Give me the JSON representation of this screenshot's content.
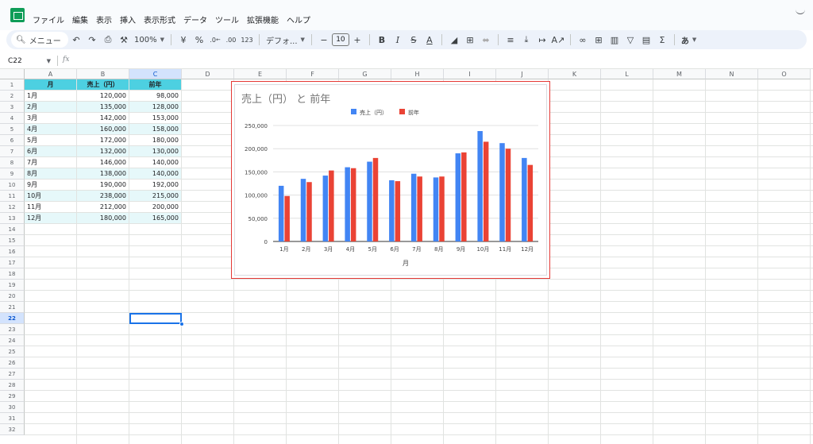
{
  "menu": {
    "items": [
      "ファイル",
      "編集",
      "表示",
      "挿入",
      "表示形式",
      "データ",
      "ツール",
      "拡張機能",
      "ヘルプ"
    ]
  },
  "toolbar": {
    "search_label": "メニュー",
    "zoom": "100%",
    "currency": "¥",
    "percent": "%",
    "dec_decrease": ".0←",
    "dec_increase": ".00",
    "number_format": "123",
    "font": "デフォ...",
    "font_size": "10",
    "bold": "B",
    "italic": "I",
    "strike": "S",
    "text_color": "A",
    "sum": "Σ",
    "input_tools": "あ",
    "icons": [
      "search-icon",
      "undo-icon",
      "redo-icon",
      "print-icon",
      "paint-format-icon",
      "zoom-dropdown-icon",
      "minus-icon",
      "plus-icon",
      "fill-color-icon",
      "borders-icon",
      "merge-cells-icon",
      "align-left-icon",
      "valign-icon",
      "wrap-icon",
      "rotate-icon",
      "link-icon",
      "comment-icon",
      "chart-icon",
      "filter-icon",
      "filter-views-icon",
      "functions-icon",
      "input-tools-icon"
    ]
  },
  "formula_bar": {
    "name_box": "C22",
    "fx": "fx"
  },
  "grid": {
    "columns": [
      "A",
      "B",
      "C",
      "D",
      "E",
      "F",
      "G",
      "H",
      "I",
      "J",
      "K",
      "L",
      "M",
      "N",
      "O"
    ],
    "rows": [
      "1",
      "2",
      "3",
      "4",
      "5",
      "6",
      "7",
      "8",
      "9",
      "10",
      "11",
      "12",
      "13",
      "14",
      "15",
      "16",
      "17",
      "18",
      "19",
      "20",
      "21",
      "22",
      "23",
      "24",
      "25",
      "26",
      "27",
      "28",
      "29",
      "30",
      "31",
      "32"
    ],
    "selected_column": "C",
    "selected_row": "22",
    "selected_cell": "C22"
  },
  "sheet": {
    "headers": [
      "月",
      "売上（円）",
      "前年"
    ],
    "rows": [
      [
        "1月",
        "120,000",
        "98,000"
      ],
      [
        "2月",
        "135,000",
        "128,000"
      ],
      [
        "3月",
        "142,000",
        "153,000"
      ],
      [
        "4月",
        "160,000",
        "158,000"
      ],
      [
        "5月",
        "172,000",
        "180,000"
      ],
      [
        "6月",
        "132,000",
        "130,000"
      ],
      [
        "7月",
        "146,000",
        "140,000"
      ],
      [
        "8月",
        "138,000",
        "140,000"
      ],
      [
        "9月",
        "190,000",
        "192,000"
      ],
      [
        "10月",
        "238,000",
        "215,000"
      ],
      [
        "11月",
        "212,000",
        "200,000"
      ],
      [
        "12月",
        "180,000",
        "165,000"
      ]
    ],
    "colors": {
      "header": "#4dd0e1",
      "band": "#e6f8fa"
    }
  },
  "chart_data": {
    "type": "bar",
    "title": "売上（円） と 前年",
    "xlabel": "月",
    "ylabel": "",
    "categories": [
      "1月",
      "2月",
      "3月",
      "4月",
      "5月",
      "6月",
      "7月",
      "8月",
      "9月",
      "10月",
      "11月",
      "12月"
    ],
    "series": [
      {
        "name": "売上（円）",
        "color": "#4285f4",
        "values": [
          120000,
          135000,
          142000,
          160000,
          172000,
          132000,
          146000,
          138000,
          190000,
          238000,
          212000,
          180000
        ]
      },
      {
        "name": "前年",
        "color": "#ea4335",
        "values": [
          98000,
          128000,
          153000,
          158000,
          180000,
          130000,
          140000,
          140000,
          192000,
          215000,
          200000,
          165000
        ]
      }
    ],
    "ylim": [
      0,
      250000
    ],
    "yticks": [
      "0",
      "50,000",
      "100,000",
      "150,000",
      "200,000",
      "250,000"
    ],
    "grid": true,
    "legend": "top"
  }
}
